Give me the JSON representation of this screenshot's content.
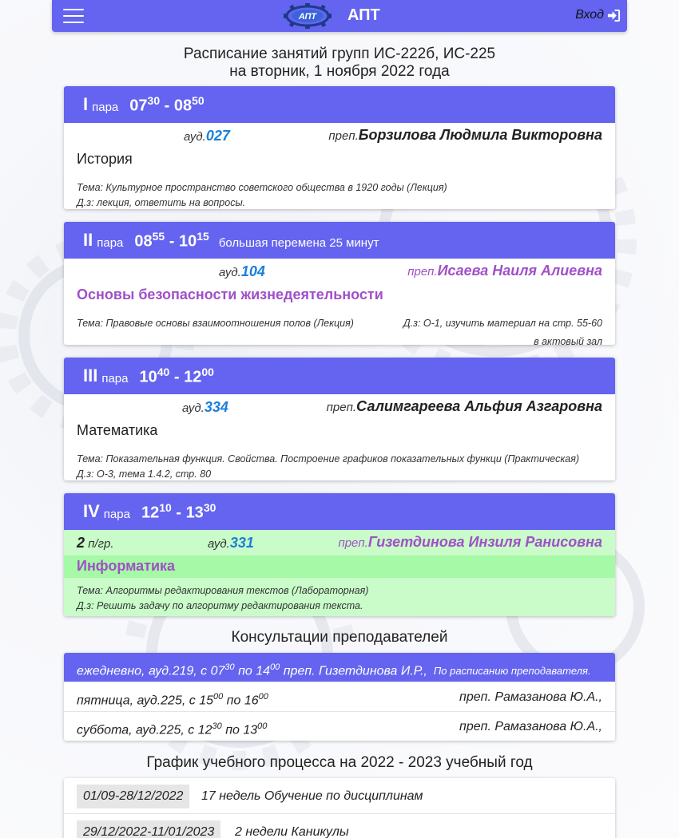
{
  "header": {
    "brand": "АПТ",
    "logo_text": "АПТ",
    "login_label": "Вход"
  },
  "title": {
    "line1": "Расписание занятий групп ИС-222б, ИС-225",
    "line2": "на вторник, 1 ноября 2022 года"
  },
  "lessons": [
    {
      "roman": "I",
      "para": "пара",
      "start_h": "07",
      "start_m": "30",
      "end_h": "08",
      "end_m": "50",
      "note": "",
      "aud_label": "ауд.",
      "aud": "027",
      "prep_label": "преп.",
      "teacher": "Борзилова Людмила Викторовна",
      "subject": "История",
      "topic": "Тема: Культурное пространство советского общества в 1920 годы (Лекция)",
      "homework": "Д.з: лекция, ответить на вопросы."
    },
    {
      "roman": "II",
      "para": "пара",
      "start_h": "08",
      "start_m": "55",
      "end_h": "10",
      "end_m": "15",
      "note": "большая перемена 25 минут",
      "aud_label": "ауд.",
      "aud": "104",
      "prep_label": "преп.",
      "teacher": "Исаева Наиля Алиевна",
      "subject": "Основы безопасности жизнедеятельности",
      "topic": "Тема: Правовые основы взаимоотношения полов (Лекция)",
      "homework_line1": "Д.з: О-1, изучить материал на стр. 55-60",
      "homework_line2": "в актовый зал"
    },
    {
      "roman": "III",
      "para": "пара",
      "start_h": "10",
      "start_m": "40",
      "end_h": "12",
      "end_m": "00",
      "note": "",
      "aud_label": "ауд.",
      "aud": "334",
      "prep_label": "преп.",
      "teacher": "Салимгареева Альфия Азгаровна",
      "subject": "Математика",
      "topic": "Тема: Показательная функция. Свойства. Построение графиков показательных функци (Практическая)",
      "homework": "Д.з: О-3, тема 1.4.2, стр. 80"
    },
    {
      "roman": "IV",
      "para": "пара",
      "start_h": "12",
      "start_m": "10",
      "end_h": "13",
      "end_m": "30",
      "note": "",
      "subgroup": "2",
      "subgroup_label": "п/гр.",
      "aud_label": "ауд.",
      "aud": "331",
      "prep_label": "преп.",
      "teacher": "Гизетдинова Инзиля Ранисовна",
      "subject": "Информатика",
      "topic": "Тема: Алгоритмы редактирования текстов (Лабораторная)",
      "homework": "Д.з: Решить задачу по алгоритму редактирования текста."
    }
  ],
  "consultations": {
    "title": "Консультации преподавателей",
    "head": {
      "pre": "ежедневно,  ауд.219,  с 07",
      "m1": "30",
      "mid": " по 14",
      "m2": "00",
      "teacher": "  преп. Гизетдинова И.Р.,",
      "note": "По расписанию преподавателя."
    },
    "rows": [
      {
        "pre": "пятница,  ауд.225,  с 15",
        "m1": "00",
        "mid": " по 16",
        "m2": "00",
        "teacher": "преп. Рамазанова Ю.А.,"
      },
      {
        "pre": "суббота,  ауд.225,  с 12",
        "m1": "30",
        "mid": " по 13",
        "m2": "00",
        "teacher": "преп. Рамазанова Ю.А.,"
      }
    ]
  },
  "process": {
    "title": "График учебного процесса на 2022 - 2023 учебный год",
    "rows": [
      {
        "dates": "01/09-28/12/2022",
        "text": "17 недель  Обучение по дисциплинам"
      },
      {
        "dates": "29/12/2022-11/01/2023",
        "text": "2 недели  Каникулы"
      }
    ]
  },
  "colors": {
    "accent": "#6464f0",
    "aud": "#1a7fd8",
    "highlight": "#a050c8",
    "green": "#c9fcc9"
  }
}
